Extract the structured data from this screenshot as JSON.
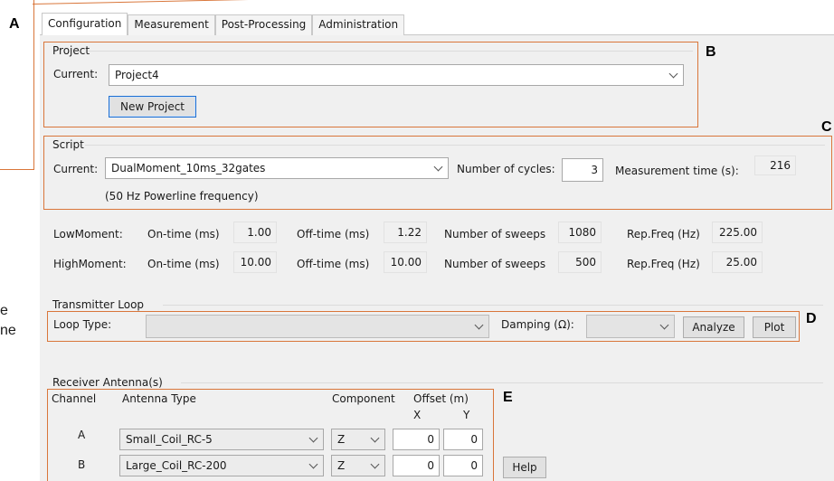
{
  "callouts": {
    "a": "A",
    "b": "B",
    "c": "C",
    "d": "D",
    "e": "E"
  },
  "left_fragment": {
    "line1": "e",
    "line2": "ne"
  },
  "tabs": [
    {
      "label": "Configuration",
      "active": true
    },
    {
      "label": "Measurement",
      "active": false
    },
    {
      "label": "Post-Processing",
      "active": false
    },
    {
      "label": "Administration",
      "active": false
    }
  ],
  "project": {
    "group_title": "Project",
    "current_label": "Current:",
    "current_value": "Project4",
    "new_button": "New Project"
  },
  "script": {
    "group_title": "Script",
    "current_label": "Current:",
    "current_value": "DualMoment_10ms_32gates",
    "cycles_label": "Number of cycles:",
    "cycles_value": "3",
    "time_label": "Measurement time (s):",
    "time_value": "216",
    "powerline_note": "(50 Hz Powerline frequency)"
  },
  "moments": [
    {
      "name": "LowMoment:",
      "on_label": "On-time (ms)",
      "on": "1.00",
      "off_label": "Off-time (ms)",
      "off": "1.22",
      "sweeps_label": "Number of sweeps",
      "sweeps": "1080",
      "rep_label": "Rep.Freq (Hz)",
      "rep": "225.00"
    },
    {
      "name": "HighMoment:",
      "on_label": "On-time (ms)",
      "on": "10.00",
      "off_label": "Off-time (ms)",
      "off": "10.00",
      "sweeps_label": "Number of sweeps",
      "sweeps": "500",
      "rep_label": "Rep.Freq (Hz)",
      "rep": "25.00"
    }
  ],
  "transmitter": {
    "group_title": "Transmitter Loop",
    "loop_type_label": "Loop Type:",
    "loop_type_value": "",
    "damping_label": "Damping (Ω):",
    "damping_value": "",
    "analyze_button": "Analyze",
    "plot_button": "Plot"
  },
  "receiver": {
    "group_title": "Receiver Antenna(s)",
    "headers": {
      "channel": "Channel",
      "antenna": "Antenna Type",
      "component": "Component",
      "offset": "Offset (m)",
      "x": "X",
      "y": "Y"
    },
    "rows": [
      {
        "channel": "A",
        "antenna": "Small_Coil_RC-5",
        "component": "Z",
        "x": "0",
        "y": "0"
      },
      {
        "channel": "B",
        "antenna": "Large_Coil_RC-200",
        "component": "Z",
        "x": "0",
        "y": "0"
      }
    ],
    "help_button": "Help"
  },
  "colors": {
    "highlight": "#d9763a",
    "panel": "#f0f0f0",
    "focus": "#1f6fd1"
  }
}
